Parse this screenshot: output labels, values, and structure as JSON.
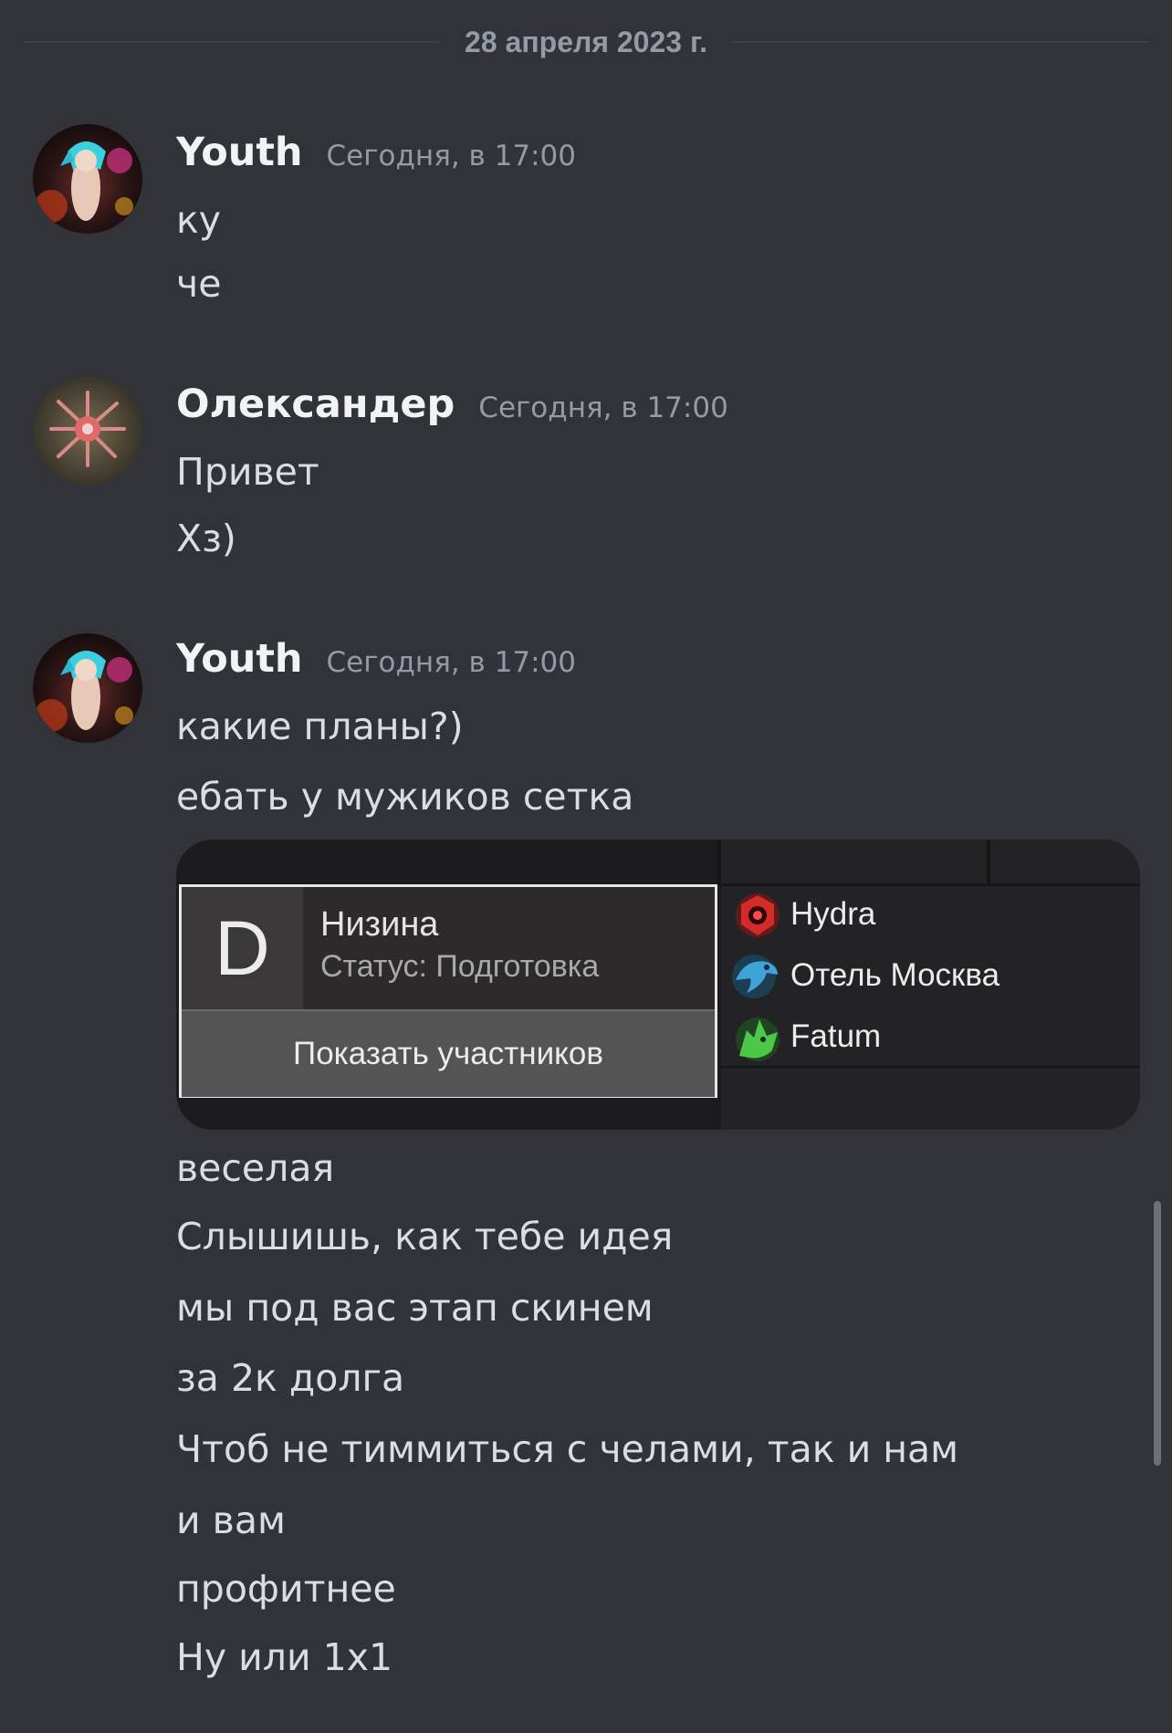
{
  "date_divider": "28 апреля 2023 г.",
  "messages": [
    {
      "username": "Youth",
      "timestamp": "Сегодня, в 17:00",
      "lines": [
        "ку",
        "че"
      ]
    },
    {
      "username": "Олександер",
      "timestamp": "Сегодня, в 17:00",
      "lines": [
        "Привет",
        "Хз)"
      ]
    },
    {
      "username": "Youth",
      "timestamp": "Сегодня, в 17:00",
      "lines_before_embed": [
        "какие планы?)",
        "ебать у мужиков сетка"
      ],
      "embed": {
        "group_letter": "D",
        "team_name": "Низина",
        "team_status": "Статус: Подготовка",
        "show_members_label": "Показать участников",
        "teams": [
          {
            "name": "Hydra",
            "icon": "hydra-logo-icon",
            "color": "#d42a2a"
          },
          {
            "name": "Отель Москва",
            "icon": "eagle-logo-icon",
            "color": "#3fa3d8"
          },
          {
            "name": "Fatum",
            "icon": "wolf-logo-icon",
            "color": "#49c84a"
          }
        ]
      },
      "lines_after_embed": [
        "веселая",
        "Слышишь, как тебе идея",
        "мы под вас этап скинем",
        "за 2к долга",
        "Чтоб не тиммиться с челами, так и нам",
        "и вам",
        "профитнее",
        "Ну или 1х1"
      ]
    }
  ],
  "colors": {
    "background": "#313338",
    "username": "#f2f3f5",
    "timestamp": "#949ba4",
    "message_text": "#dbdee1"
  }
}
